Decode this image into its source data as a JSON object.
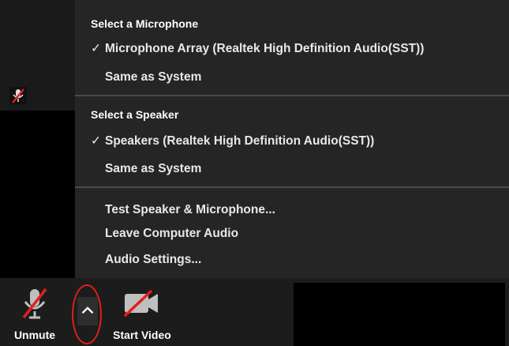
{
  "menu": {
    "microphone_header": "Select a Microphone",
    "microphones": [
      {
        "label": "Microphone Array (Realtek High Definition Audio(SST))",
        "checked": true
      },
      {
        "label": "Same as System",
        "checked": false
      }
    ],
    "speaker_header": "Select a Speaker",
    "speakers": [
      {
        "label": "Speakers (Realtek High Definition Audio(SST))",
        "checked": true
      },
      {
        "label": "Same as System",
        "checked": false
      }
    ],
    "actions": [
      "Test Speaker & Microphone...",
      "Leave Computer Audio",
      "Audio Settings..."
    ],
    "check_glyph": "✓"
  },
  "toolbar": {
    "unmute_label": "Unmute",
    "start_video_label": "Start Video"
  },
  "icons": {
    "muted_mic": "mic-off-icon",
    "video_off": "video-off-icon",
    "caret": "caret-up-icon"
  },
  "colors": {
    "menu_bg": "#252525",
    "toolbar_bg": "#1c1c1c",
    "mute_red": "#e0201c",
    "highlight_ring": "#e0201c"
  }
}
